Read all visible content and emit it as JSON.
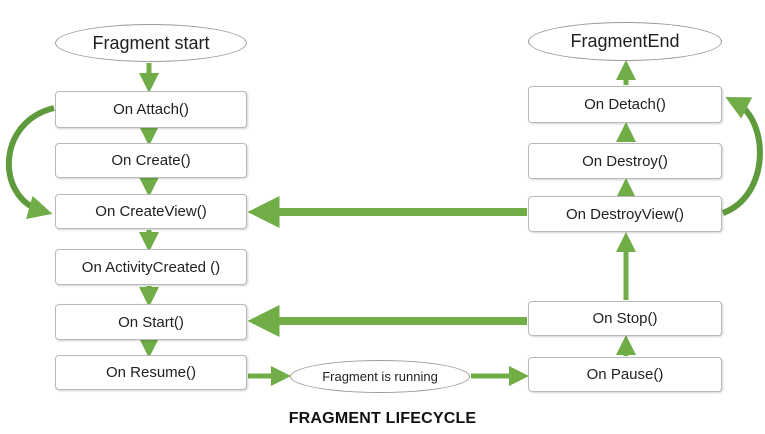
{
  "colors": {
    "arrow": "#70ad47",
    "node_border": "#b9b9b9",
    "ellipse_border": "#9a9a9a",
    "text": "#1f1f1f",
    "background": "#ffffff"
  },
  "diagram": {
    "start": "Fragment start",
    "end": "FragmentEnd",
    "running": "Fragment is running",
    "left_column": {
      "attach": "On Attach()",
      "create": "On Create()",
      "create_view": "On CreateView()",
      "activity_created": "On ActivityCreated ()",
      "start": "On Start()",
      "resume": "On Resume()"
    },
    "right_column": {
      "detach": "On Detach()",
      "destroy": "On Destroy()",
      "destroy_view": "On DestroyView()",
      "stop": "On Stop()",
      "pause": "On Pause()"
    },
    "caption": "FRAGMENT LIFECYCLE"
  }
}
